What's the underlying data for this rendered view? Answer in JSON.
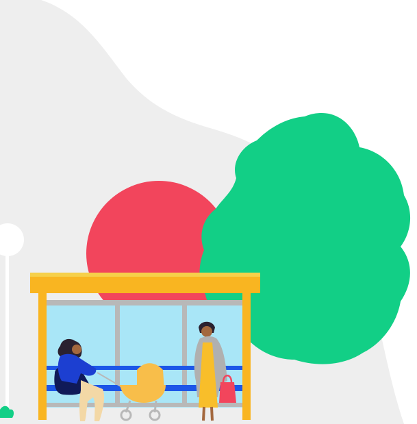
{
  "scene": {
    "description_text": "",
    "colors": {
      "background": "#ffffff",
      "hill": "#eeeeee",
      "sun": "#f2455c",
      "tree": "#12cf86",
      "shelter_roof": "#f9b521",
      "shelter_roof_highlight": "#f6d04a",
      "shelter_posts": "#f9b521",
      "shelter_glass": "#a9e6f7",
      "shelter_frame": "#b8b8b8",
      "bench": "#1c56e8",
      "lamp": "#ffffff",
      "pram": "#f8be4a",
      "woman_top": "#1c3fd1",
      "woman_skirt": "#101a58",
      "woman_pants": "#f3d8a6",
      "woman_hair": "#2a2130",
      "standing_coat": "#b0b0b0",
      "standing_dress": "#f8be2a",
      "bag": "#f2455c",
      "skin": "#a3683e"
    },
    "icons": [
      "tree-icon",
      "sun-icon",
      "bus-shelter-icon",
      "street-lamp-icon",
      "pram-icon",
      "person-icon"
    ]
  }
}
